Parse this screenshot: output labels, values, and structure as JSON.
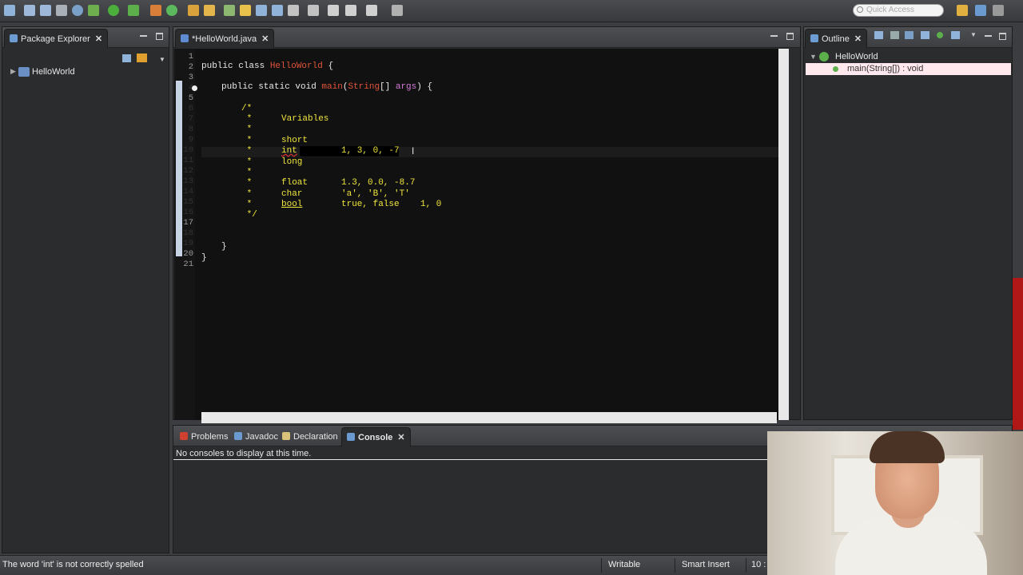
{
  "toolbar": {
    "quick_access_placeholder": "Quick Access"
  },
  "package_explorer": {
    "tab_label": "Package Explorer",
    "project": "HelloWorld"
  },
  "editor": {
    "tab_label": "*HelloWorld.java",
    "line_numbers": [
      "1",
      "2",
      "3",
      "4",
      "5",
      "6",
      "7",
      "8",
      "9",
      "10",
      "11",
      "12",
      "13",
      "14",
      "15",
      "16",
      "17",
      "18",
      "19",
      "20",
      "21"
    ],
    "lines": {
      "l2a": "public class ",
      "l2b": "HelloWorld",
      "l2c": " {",
      "l4a": "public static void ",
      "l4b": "main",
      "l4c": "(",
      "l4d": "String",
      "l4e": "[] ",
      "l4f": "args",
      "l4g": ") {",
      "l6": "/*",
      "l7a": " *",
      "l7b": "Variables",
      "l8": " *",
      "l9a": " *",
      "l9b": "short",
      "l10a": " *",
      "l10b": "int",
      "l10c": "1, 3, 0, -7",
      "l11a": " *",
      "l11b": "long",
      "l12": " *",
      "l13a": " *",
      "l13b": "float",
      "l13c": "1.3, 0.0, -8.7",
      "l14a": " *",
      "l14b": "char",
      "l14c": "'a', 'B', 'T'",
      "l15a": " *",
      "l15b": "bool",
      "l15c": "true, false",
      "l15d": "1, 0",
      "l16": " */",
      "l19": "}",
      "l20": "}"
    }
  },
  "outline": {
    "tab_label": "Outline",
    "class_name": "HelloWorld",
    "method": "main(String[]) : void"
  },
  "bottom_panel": {
    "tabs": [
      "Problems",
      "Javadoc",
      "Declaration",
      "Console"
    ],
    "console_message": "No consoles to display at this time."
  },
  "statusbar": {
    "message": "The word 'int' is not correctly spelled",
    "writable": "Writable",
    "insert_mode": "Smart Insert",
    "position": "10 :"
  },
  "colors": {
    "comment": "#f0e53c",
    "class_name": "#e1543a",
    "param": "#d47cd8",
    "selection": "#ffe8ee"
  }
}
